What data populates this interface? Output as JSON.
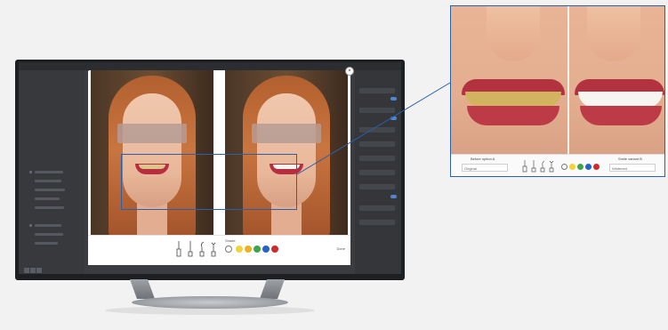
{
  "app": {
    "title": "",
    "sidebar_items": 9,
    "colors": {
      "frame": "#1d1f22",
      "screen": "#3a3c40",
      "accent": "#2d5fa6"
    }
  },
  "modal": {
    "close_label": "×",
    "shade_label": "Shade",
    "action_label": "Done",
    "swatches": [
      "#f1d23a",
      "#f0b020",
      "#3fa54a",
      "#2762c9",
      "#d12a2a"
    ],
    "tools": [
      "brush-icon",
      "pen-icon",
      "hook-icon",
      "smile-icon"
    ]
  },
  "zoom": {
    "left_select_label": "Before option A",
    "left_select_value": "Original",
    "right_select_label": "Smile variant B",
    "right_select_value": "Whitened",
    "swatches": [
      "#f1d23a",
      "#f0b020",
      "#3fa54a",
      "#2762c9",
      "#d12a2a"
    ]
  }
}
